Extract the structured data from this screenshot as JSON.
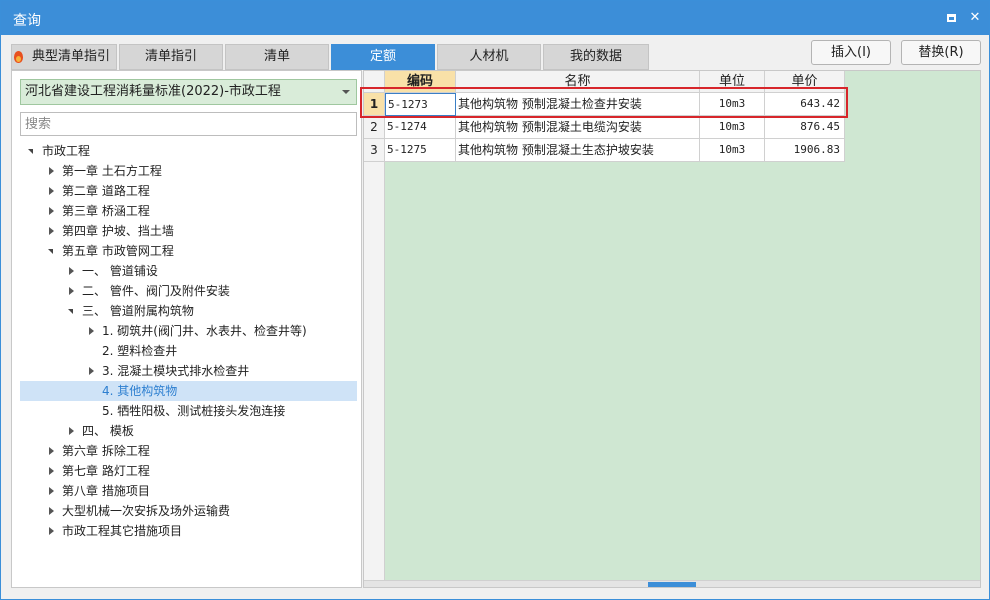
{
  "window": {
    "title": "查询"
  },
  "tabs": [
    {
      "label": "典型清单指引"
    },
    {
      "label": "清单指引"
    },
    {
      "label": "清单"
    },
    {
      "label": "定额"
    },
    {
      "label": "人材机"
    },
    {
      "label": "我的数据"
    }
  ],
  "active_tab": "定额",
  "actions": {
    "insert": "插入(I)",
    "replace": "替换(R)"
  },
  "library": {
    "selected": "河北省建设工程消耗量标准(2022)-市政工程"
  },
  "search": {
    "placeholder": "搜索",
    "value": ""
  },
  "tree": [
    {
      "label": "市政工程",
      "level": 0,
      "state": "expanded"
    },
    {
      "label": "第一章 土石方工程",
      "level": 1,
      "state": "collapsed"
    },
    {
      "label": "第二章 道路工程",
      "level": 1,
      "state": "collapsed"
    },
    {
      "label": "第三章 桥涵工程",
      "level": 1,
      "state": "collapsed"
    },
    {
      "label": "第四章 护坡、挡土墙",
      "level": 1,
      "state": "collapsed"
    },
    {
      "label": "第五章 市政管网工程",
      "level": 1,
      "state": "expanded"
    },
    {
      "label": "一、 管道铺设",
      "level": 2,
      "state": "collapsed"
    },
    {
      "label": "二、 管件、阀门及附件安装",
      "level": 2,
      "state": "collapsed"
    },
    {
      "label": "三、 管道附属构筑物",
      "level": 2,
      "state": "expanded"
    },
    {
      "label": "1. 砌筑井(阀门井、水表井、检查井等)",
      "level": 3,
      "state": "collapsed"
    },
    {
      "label": "2. 塑料检查井",
      "level": 3,
      "state": "leaf"
    },
    {
      "label": "3. 混凝土模块式排水检查井",
      "level": 3,
      "state": "collapsed"
    },
    {
      "label": "4. 其他构筑物",
      "level": 3,
      "state": "leaf",
      "selected": true
    },
    {
      "label": "5. 牺牲阳极、测试桩接头发泡连接",
      "level": 3,
      "state": "leaf"
    },
    {
      "label": "四、 模板",
      "level": 2,
      "state": "collapsed"
    },
    {
      "label": "第六章 拆除工程",
      "level": 1,
      "state": "collapsed"
    },
    {
      "label": "第七章 路灯工程",
      "level": 1,
      "state": "collapsed"
    },
    {
      "label": "第八章 措施项目",
      "level": 1,
      "state": "collapsed"
    },
    {
      "label": "大型机械一次安拆及场外运输费",
      "level": 1,
      "state": "collapsed"
    },
    {
      "label": "市政工程其它措施项目",
      "level": 1,
      "state": "collapsed"
    }
  ],
  "grid": {
    "columns": [
      "编码",
      "名称",
      "单位",
      "单价"
    ],
    "rows": [
      {
        "no": "1",
        "code": "5-1273",
        "name": "其他构筑物 预制混凝土检查井安装",
        "unit": "10m3",
        "price": "643.42"
      },
      {
        "no": "2",
        "code": "5-1274",
        "name": "其他构筑物 预制混凝土电缆沟安装",
        "unit": "10m3",
        "price": "876.45"
      },
      {
        "no": "3",
        "code": "5-1275",
        "name": "其他构筑物 预制混凝土生态护坡安装",
        "unit": "10m3",
        "price": "1906.83"
      }
    ]
  }
}
